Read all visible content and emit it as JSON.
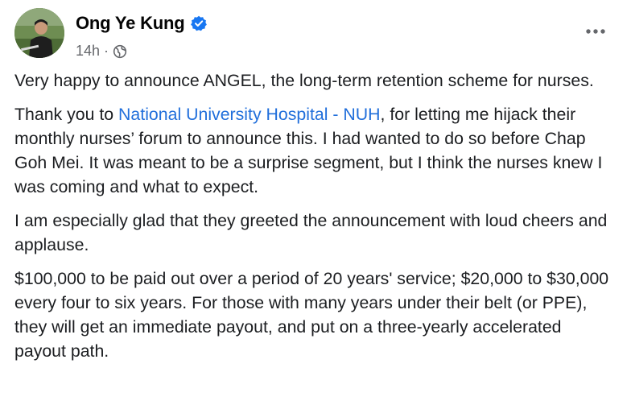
{
  "post": {
    "author": "Ong Ye Kung",
    "time": "14h",
    "separator": "·",
    "audience_icon": "globe-icon",
    "verified_icon": "verified-badge-icon",
    "more_icon": "more-options-icon",
    "paragraphs": {
      "p1": "Very happy to announce ANGEL, the long-term retention scheme for nurses.",
      "p2_before": "Thank you to ",
      "p2_link": "National University Hospital - NUH",
      "p2_after": ", for letting me hijack their monthly nurses’ forum to announce this. I had wanted to do so before Chap Goh Mei. It was meant to be a surprise segment, but I think the nurses knew I was coming and what to expect.",
      "p3": "I am especially glad that they greeted the announcement with loud cheers and applause.",
      "p4": "$100,000 to be paid out over a period of 20 years' service; $20,000 to $30,000 every four to six years. For those with many years under their belt (or PPE), they will get an immediate payout, and put on a three-yearly accelerated payout path."
    }
  },
  "colors": {
    "link": "#216fdb",
    "verified": "#1877f2",
    "meta": "#65676b",
    "text": "#1c1e21"
  }
}
